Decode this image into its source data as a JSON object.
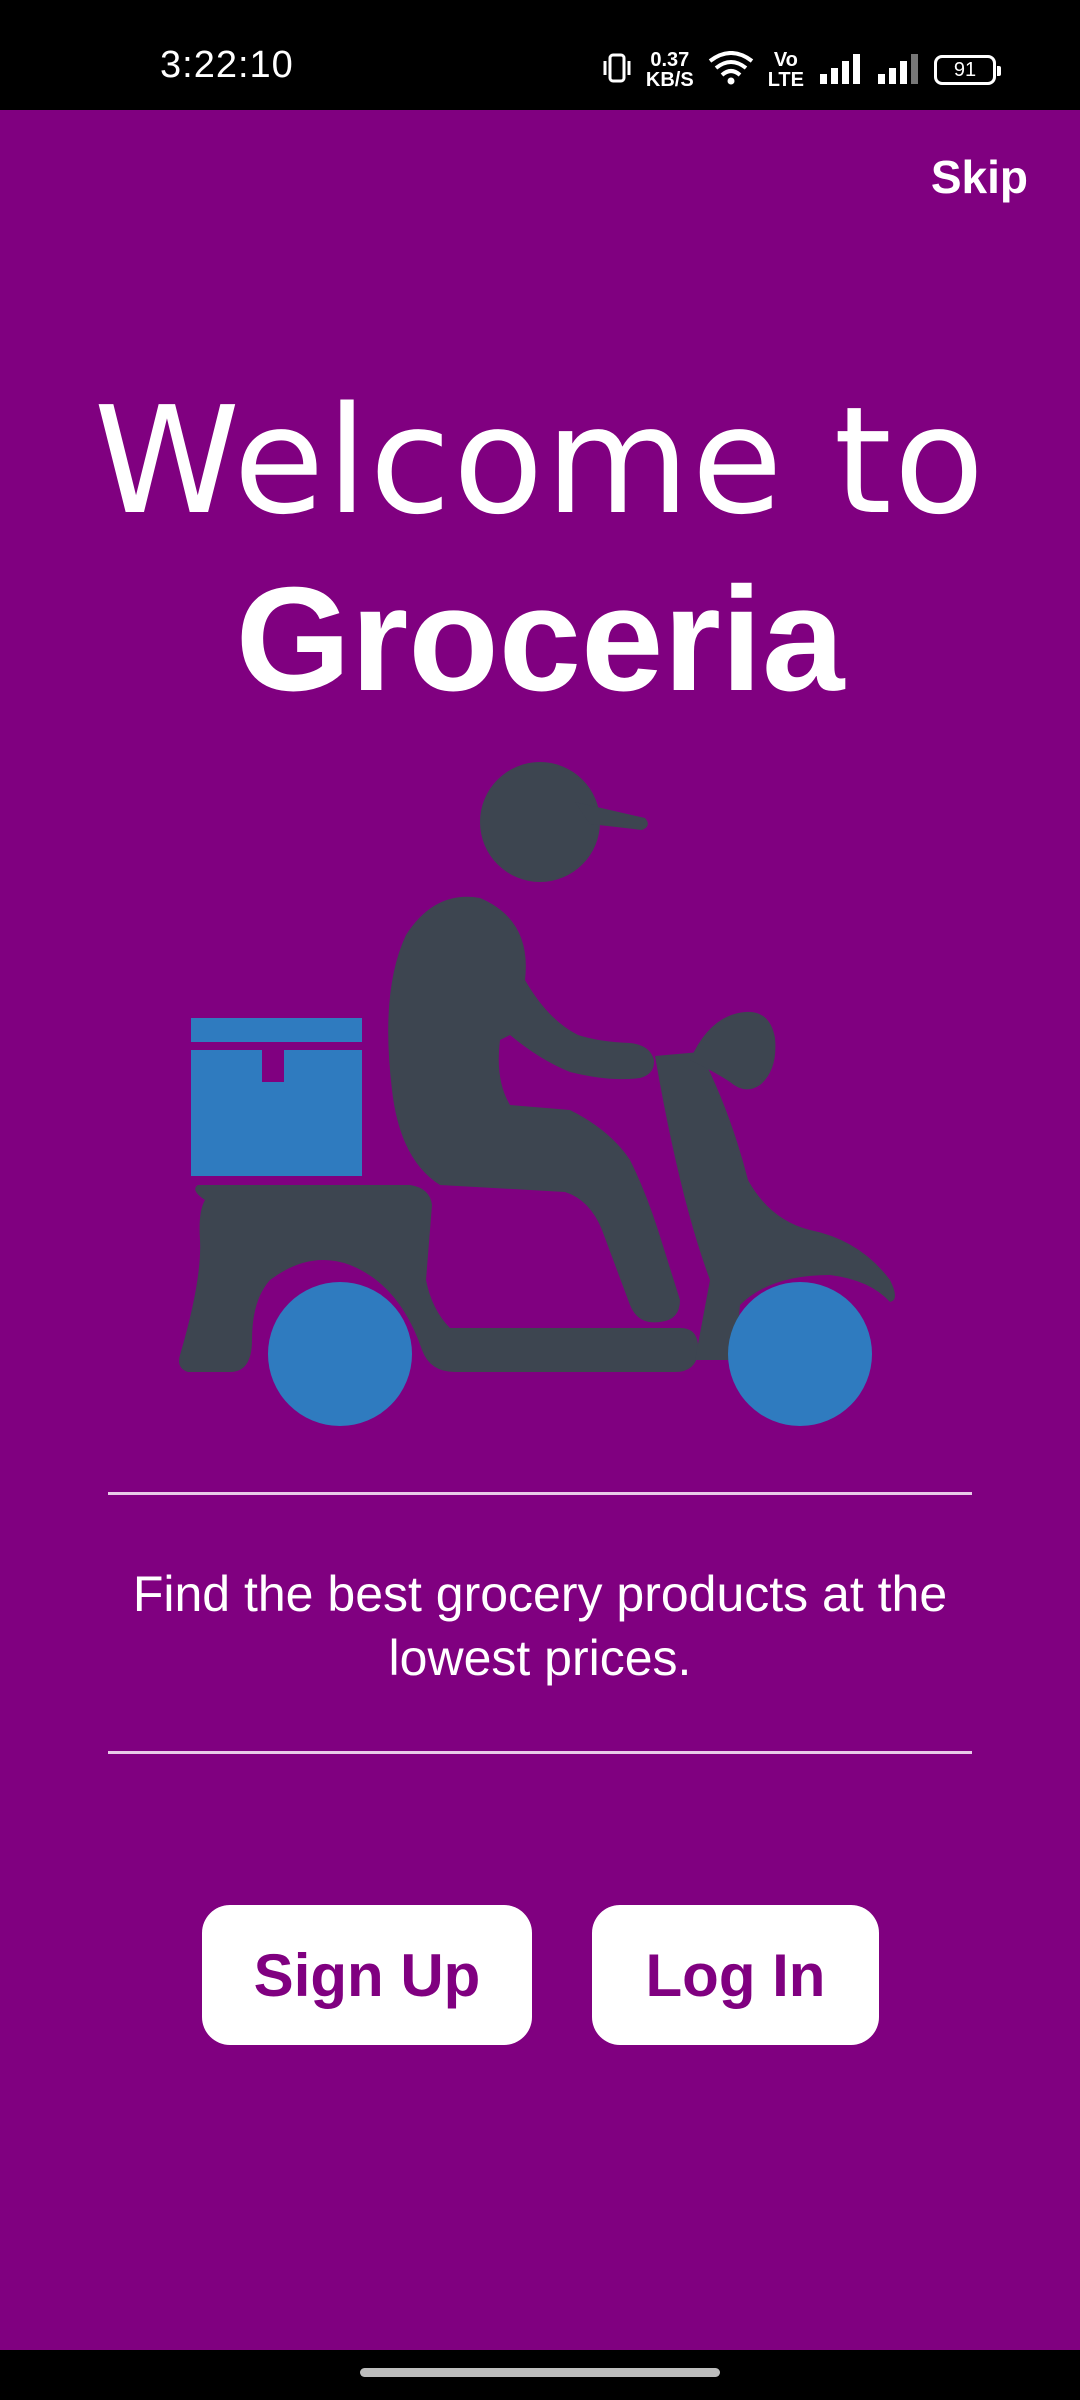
{
  "status_bar": {
    "time": "3:22:10",
    "net_speed_value": "0.37",
    "net_speed_unit": "KB/S",
    "volte_label_top": "Vo",
    "volte_label_bottom": "LTE",
    "battery_level": "91"
  },
  "header": {
    "skip_label": "Skip"
  },
  "welcome": {
    "line1": "Welcome to",
    "app_name": "Groceria"
  },
  "tagline": "Find the best grocery products at the lowest prices.",
  "actions": {
    "signup_label": "Sign Up",
    "login_label": "Log In"
  },
  "colors": {
    "background": "#800080",
    "rider": "#3d4550",
    "accent_blue": "#2f7bbf",
    "button_bg": "#ffffff",
    "button_text": "#800080"
  },
  "illustration": {
    "icon": "delivery-scooter-icon"
  }
}
